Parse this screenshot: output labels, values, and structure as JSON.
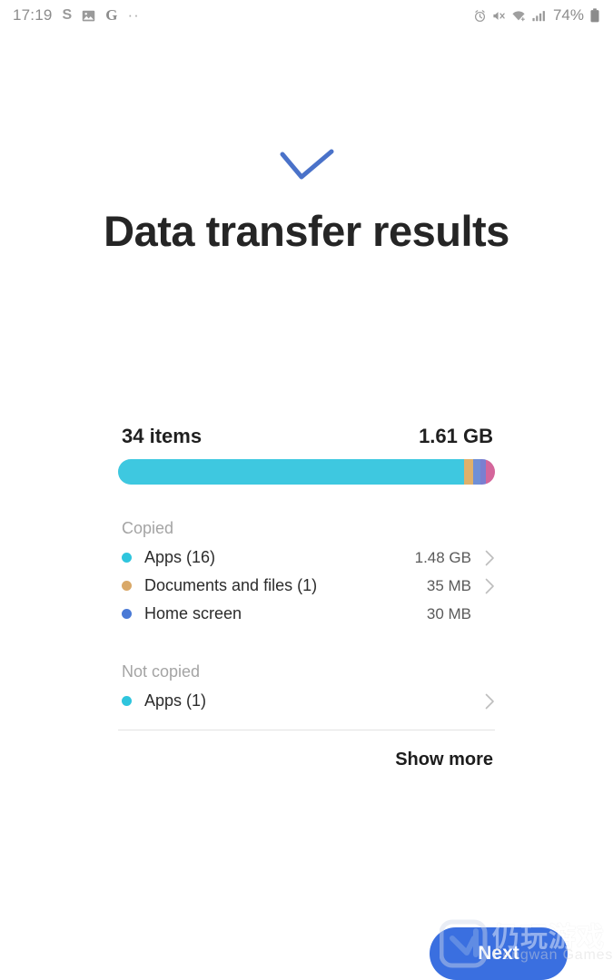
{
  "status_bar": {
    "time": "17:19",
    "left_icons": [
      {
        "name": "samsung-pay-icon",
        "glyph": "S"
      },
      {
        "name": "gallery-image-icon",
        "glyph": "image"
      },
      {
        "name": "google-icon",
        "glyph": "G"
      },
      {
        "name": "more-notifications-icon",
        "glyph": "··"
      }
    ],
    "right_icons": [
      {
        "name": "alarm-icon"
      },
      {
        "name": "mute-vibrate-icon"
      },
      {
        "name": "wifi-icon"
      },
      {
        "name": "signal-bars-icon"
      }
    ],
    "battery_percent": "74%",
    "battery_icon": "battery-icon"
  },
  "header": {
    "check_icon": "checkmark-icon",
    "check_color": "#4a72c9",
    "title": "Data transfer results"
  },
  "summary": {
    "items_label": "34 items",
    "size_label": "1.61 GB"
  },
  "progress_bar": {
    "segments": [
      {
        "name": "apps-segment",
        "color": "#3ec8e0",
        "percent": 91.9
      },
      {
        "name": "documents-segment",
        "color": "#dfb06a",
        "percent": 2.2
      },
      {
        "name": "home-screen-segment",
        "color": "#6f8fd6",
        "percent": 2.0
      },
      {
        "name": "other-segment",
        "color": "#7a7fd0",
        "percent": 1.6
      },
      {
        "name": "not-copied-segment",
        "color": "#d4669b",
        "percent": 2.3
      }
    ]
  },
  "sections": [
    {
      "label": "Copied",
      "items": [
        {
          "label": "Apps (16)",
          "size": "1.48 GB",
          "dot_color": "#2fc5dd",
          "has_chevron": true
        },
        {
          "label": "Documents and files (1)",
          "size": "35 MB",
          "dot_color": "#d9a868",
          "has_chevron": true
        },
        {
          "label": "Home screen",
          "size": "30 MB",
          "dot_color": "#4a7ad6",
          "has_chevron": false
        }
      ]
    },
    {
      "label": "Not copied",
      "items": [
        {
          "label": "Apps (1)",
          "size": "",
          "dot_color": "#2fc5dd",
          "has_chevron": true
        }
      ]
    }
  ],
  "show_more_label": "Show more",
  "next_button_label": "Next",
  "watermark": {
    "chinese": "仍玩游戏",
    "english": "Pengwan Games"
  }
}
